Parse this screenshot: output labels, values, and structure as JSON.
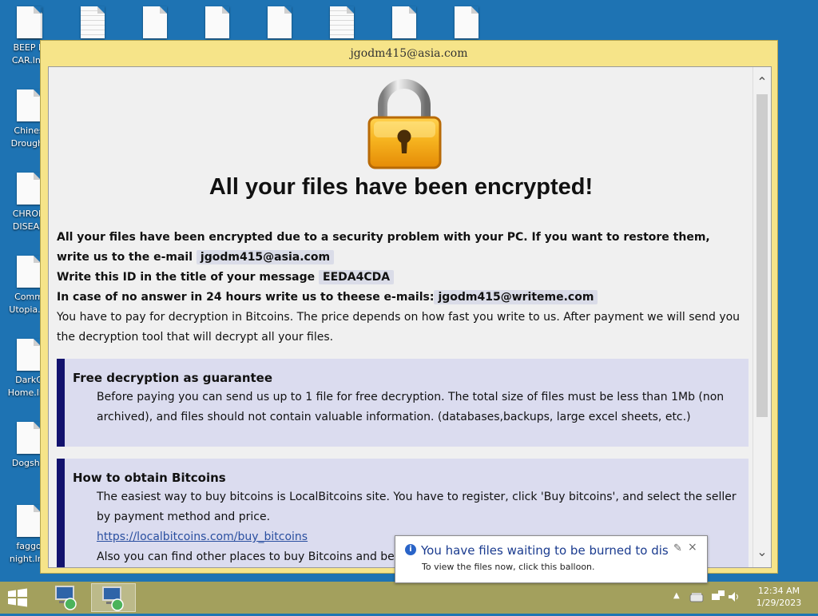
{
  "desktop": {
    "icons": [
      {
        "label": "BEEP B CAR.lnk"
      },
      {
        "label": "Chines Drought"
      },
      {
        "label": "CHRON DISEAS"
      },
      {
        "label": "Comm Utopia.ln"
      },
      {
        "label": "DarkC Home.lnk"
      },
      {
        "label": "Dogshit"
      },
      {
        "label": "faggo night.lnk"
      }
    ]
  },
  "window": {
    "title": "jgodm415@asia.com"
  },
  "note": {
    "headline": "All your files have been encrypted!",
    "intro_text": "All your files have been encrypted due to a security problem with your PC. If you want to restore them, write us to the e-mail",
    "email": "jgodm415@asia.com",
    "id_text": "Write this ID in the title of your message",
    "id": "EEDA4CDA",
    "no_answer_text": "In case of no answer in 24 hours write us to theese e-mails:",
    "backup_email": "jgodm415@writeme.com",
    "payment_text": "You have to pay for decryption in Bitcoins. The price depends on how fast you write to us. After payment we will send you the decryption tool that will decrypt all your files.",
    "sections": [
      {
        "title": "Free decryption as guarantee",
        "text": "Before paying you can send us up to 1 file for free decryption. The total size of files must be less than 1Mb (non archived), and files should not contain valuable information. (databases,backups, large excel sheets, etc.)"
      },
      {
        "title": "How to obtain Bitcoins",
        "text": "The easiest way to buy bitcoins is LocalBitcoins site. You have to register, click 'Buy bitcoins', and select the seller by payment method and price.",
        "link": "https://localbitcoins.com/buy_bitcoins",
        "more": "Also you can find other places to buy Bitcoins and beginne"
      }
    ]
  },
  "balloon": {
    "title": "You have files waiting to be burned to disc",
    "text": "To view the files now, click this balloon."
  },
  "taskbar": {
    "time": "12:34 AM",
    "date": "1/29/2023"
  }
}
